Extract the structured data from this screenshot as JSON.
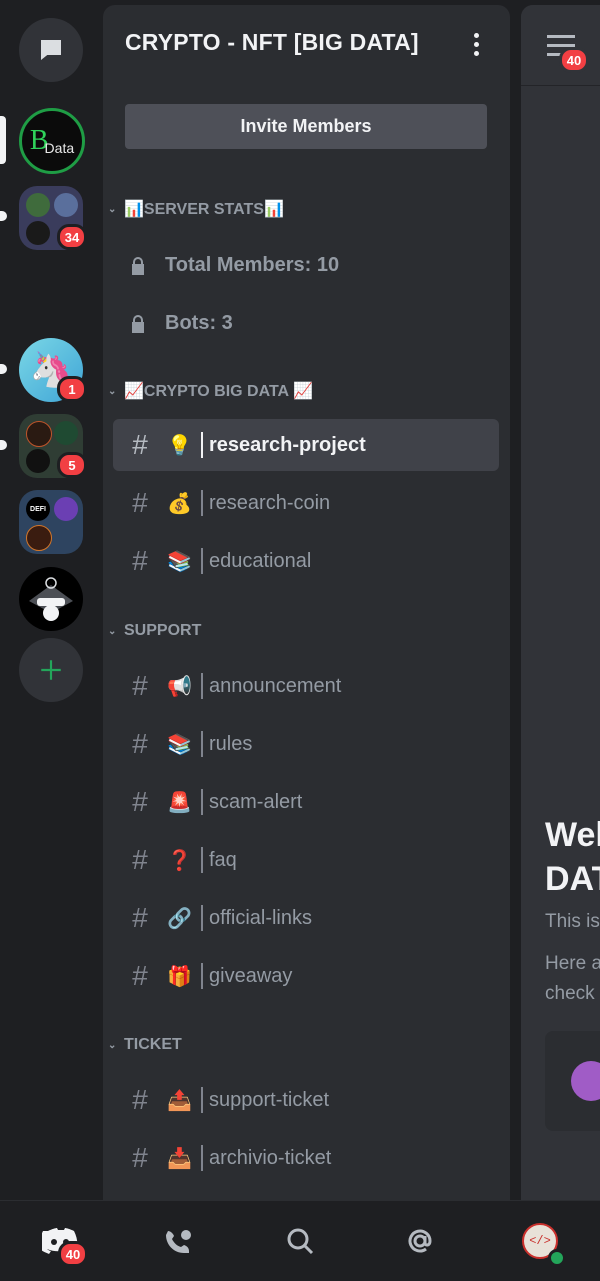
{
  "rail": {
    "badges": {
      "folder1": "34",
      "unicorn": "1",
      "folder2": "5"
    },
    "bdata_logo_text": "Data",
    "defi_label": "DEFI"
  },
  "server": {
    "name": "CRYPTO - NFT [BIG DATA]",
    "invite_label": "Invite Members"
  },
  "categories": [
    {
      "label": "📊SERVER STATS📊"
    },
    {
      "label": "📈CRYPTO BIG DATA 📈"
    },
    {
      "label": "SUPPORT"
    },
    {
      "label": "TICKET"
    }
  ],
  "stats": [
    {
      "label": "Total Members: 10"
    },
    {
      "label": "Bots: 3"
    }
  ],
  "channels": [
    {
      "emoji": "💡",
      "name": "research-project",
      "active": true
    },
    {
      "emoji": "💰",
      "name": "research-coin"
    },
    {
      "emoji": "📚",
      "name": "educational"
    },
    {
      "emoji": "📢",
      "name": "announcement"
    },
    {
      "emoji": "📚",
      "name": "rules"
    },
    {
      "emoji": "🚨",
      "name": "scam-alert"
    },
    {
      "emoji": "❓",
      "name": "faq"
    },
    {
      "emoji": "🔗",
      "name": "official-links"
    },
    {
      "emoji": "🎁",
      "name": "giveaway"
    },
    {
      "emoji": "📤",
      "name": "support-ticket"
    },
    {
      "emoji": "📥",
      "name": "archivio-ticket"
    }
  ],
  "main": {
    "header_badge": "40",
    "welcome_line1": "Wel",
    "welcome_line2": "DAT",
    "sub1": "This is",
    "sub2": "Here a",
    "sub3": "check"
  },
  "bottom_nav": {
    "home_badge": "40"
  },
  "colors": {
    "accent_green": "#23a55a",
    "badge_red": "#f23f43",
    "sidebar_bg": "#2b2d31"
  }
}
